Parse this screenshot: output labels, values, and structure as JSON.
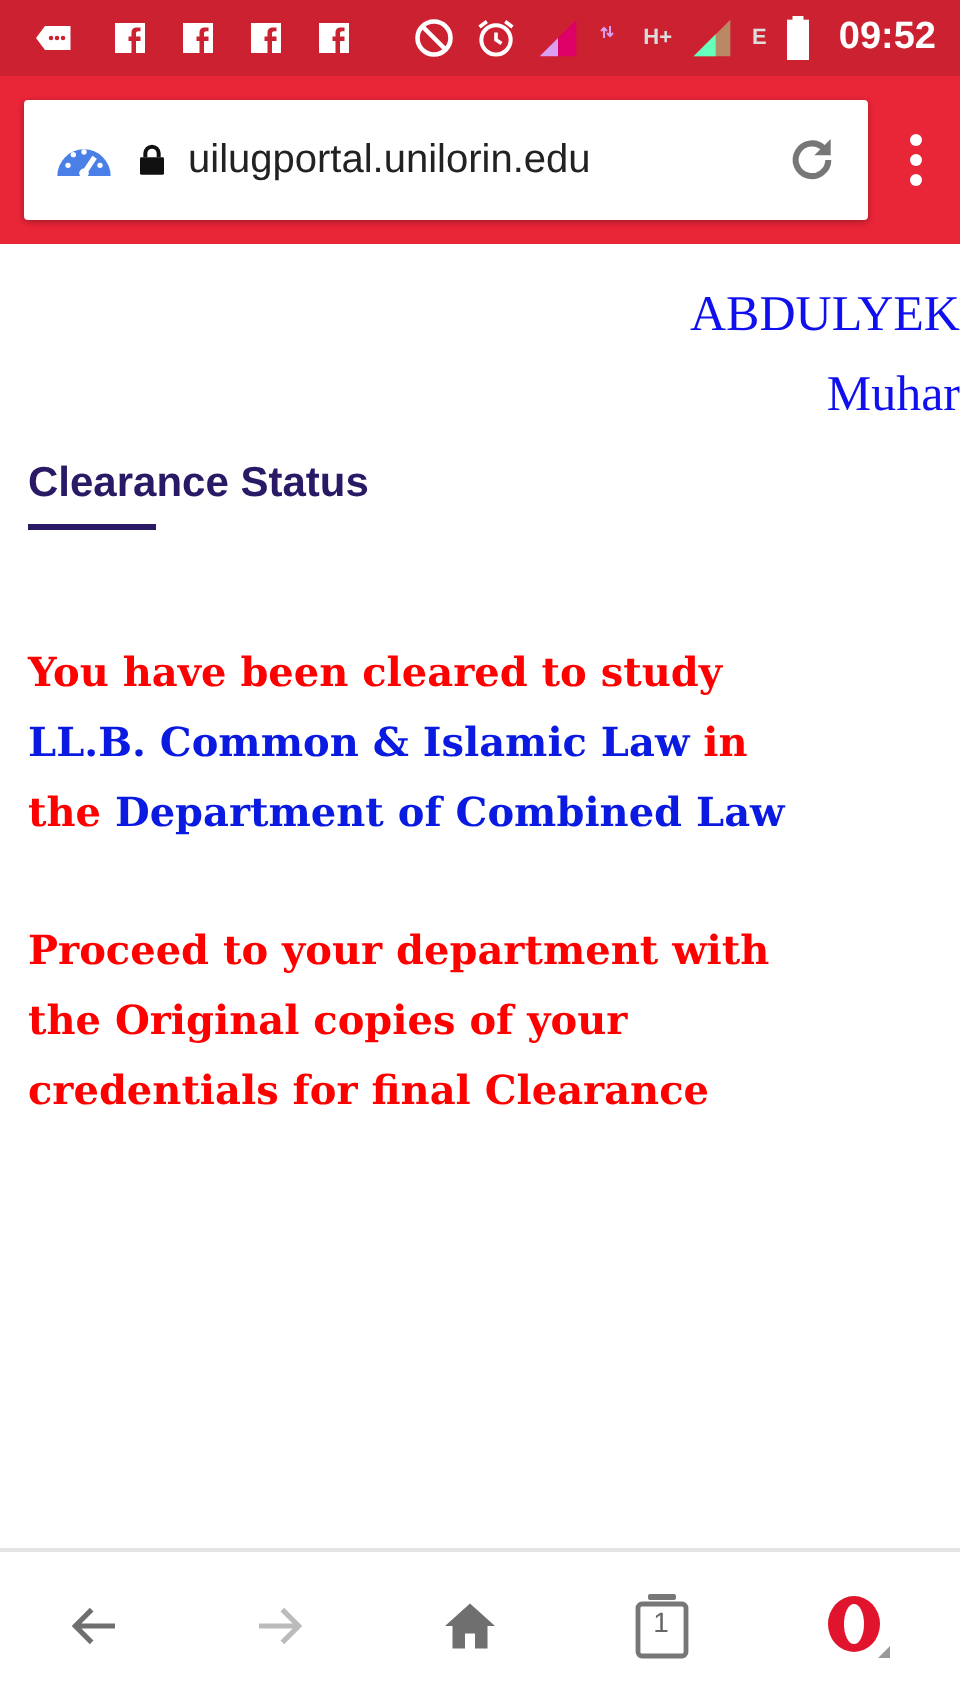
{
  "status_bar": {
    "notifications": [
      {
        "kind": "message"
      },
      {
        "kind": "facebook"
      },
      {
        "kind": "facebook"
      },
      {
        "kind": "facebook"
      },
      {
        "kind": "facebook"
      }
    ],
    "network_labels": [
      "H+",
      "E"
    ],
    "time": "09:52"
  },
  "address_bar": {
    "url": "uilugportal.unilorin.edu"
  },
  "student_name": [
    "ABDULYEK",
    "Muhar"
  ],
  "section_title": "Clearance Status",
  "messages": [
    {
      "segments": [
        {
          "text": "You have been cleared to study ",
          "emphasis": false
        },
        {
          "text": "LL.B. Common & Islamic Law",
          "emphasis": true
        },
        {
          "text": " in the ",
          "emphasis": false
        },
        {
          "text": "Department of Combined Law",
          "emphasis": true
        }
      ]
    },
    {
      "segments": [
        {
          "text": "Proceed to your department with the Original copies of your credentials for final Clearance",
          "emphasis": false
        }
      ]
    }
  ],
  "bottom_nav": {
    "back_disabled": false,
    "forward_disabled": true,
    "tab_count": "1"
  }
}
